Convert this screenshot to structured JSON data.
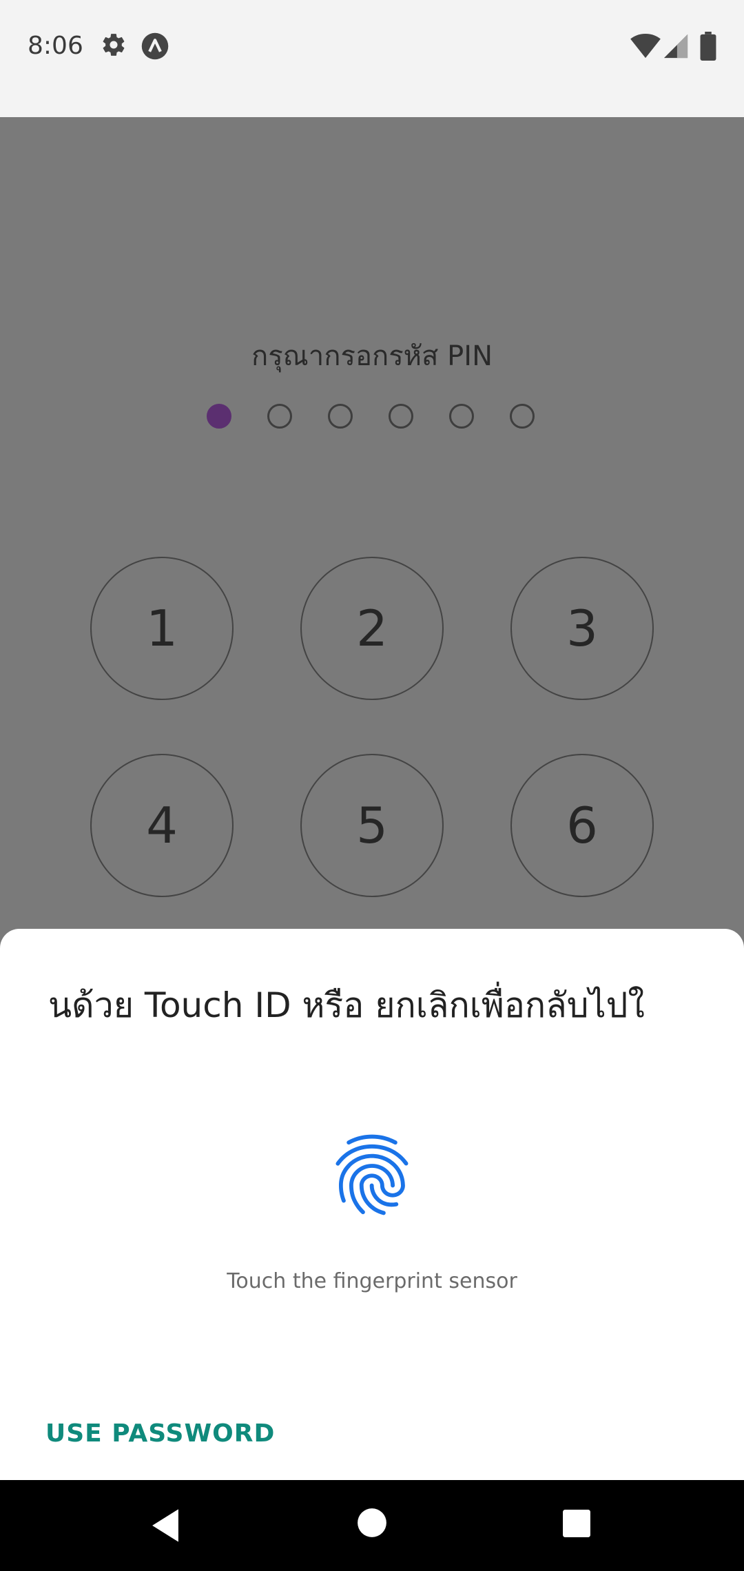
{
  "status_bar": {
    "time": "8:06",
    "icons": [
      "gear-icon",
      "app-a-icon",
      "wifi-icon",
      "signal-icon",
      "battery-icon"
    ]
  },
  "pin_screen": {
    "title": "กรุณากรอกรหัส PIN",
    "pin_length": 6,
    "pin_entered": 1,
    "accent_color": "#5b2f70",
    "keys": [
      "1",
      "2",
      "3",
      "4",
      "5",
      "6"
    ]
  },
  "fingerprint_dialog": {
    "title_visible": "นด้วย Touch ID หรือ ยกเลิกเพื่อกลับไปใ",
    "fingerprint_icon": "fingerprint-icon",
    "fingerprint_color": "#1a73e8",
    "sensor_prompt": "Touch the fingerprint sensor",
    "use_password_label": "USE PASSWORD",
    "use_password_color": "#0f8a7c"
  },
  "nav_bar": {
    "buttons": [
      "back-icon",
      "home-icon",
      "recents-icon"
    ]
  }
}
